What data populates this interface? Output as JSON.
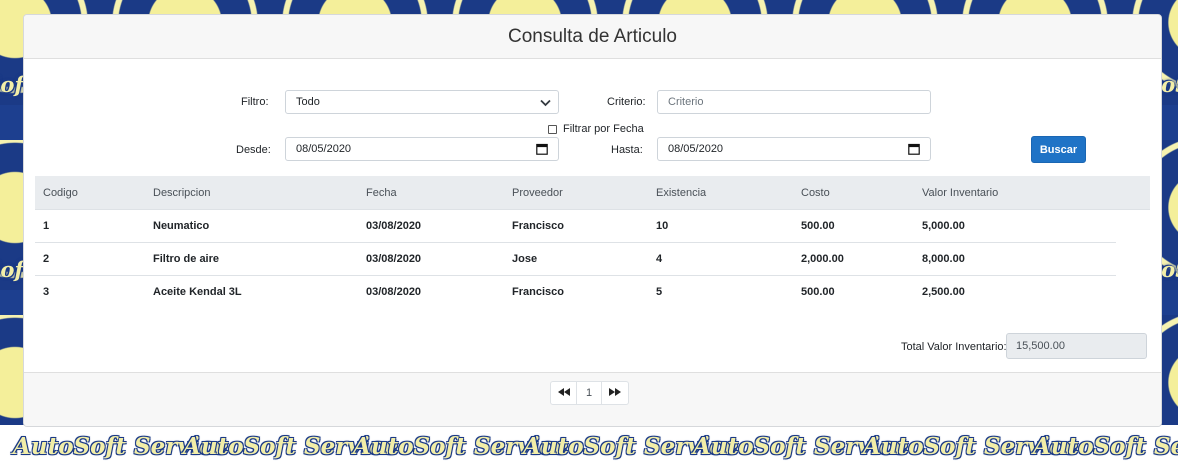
{
  "background": {
    "watermark_text": "AutoSoft Service",
    "accent_blue": "#1b3a86",
    "accent_yellow": "#f2eea8"
  },
  "page": {
    "title": "Consulta de Articulo"
  },
  "filters": {
    "filtro_label": "Filtro:",
    "filtro_value": "Todo",
    "criterio_label": "Criterio:",
    "criterio_placeholder": "Criterio",
    "filtrar_fecha_label": "Filtrar por Fecha",
    "filtrar_fecha_checked": false,
    "desde_label": "Desde:",
    "desde_value": "08/05/2020",
    "hasta_label": "Hasta:",
    "hasta_value": "08/05/2020",
    "buscar_label": "Buscar",
    "buscar_color": "#1f73c6"
  },
  "table": {
    "headers": [
      "Codigo",
      "Descripcion",
      "Fecha",
      "Proveedor",
      "Existencia",
      "Costo",
      "Valor Inventario"
    ],
    "rows": [
      [
        "1",
        "Neumatico",
        "03/08/2020",
        "Francisco",
        "10",
        "500.00",
        "5,000.00"
      ],
      [
        "2",
        "Filtro de aire",
        "03/08/2020",
        "Jose",
        "4",
        "2,000.00",
        "8,000.00"
      ],
      [
        "3",
        "Aceite Kendal 3L",
        "03/08/2020",
        "Francisco",
        "5",
        "500.00",
        "2,500.00"
      ]
    ]
  },
  "totals": {
    "label": "Total Valor Inventario:",
    "value": "15,500.00"
  },
  "pagination": {
    "first_icon": "rewind-icon",
    "current_page": "1",
    "last_icon": "fast-forward-icon"
  }
}
